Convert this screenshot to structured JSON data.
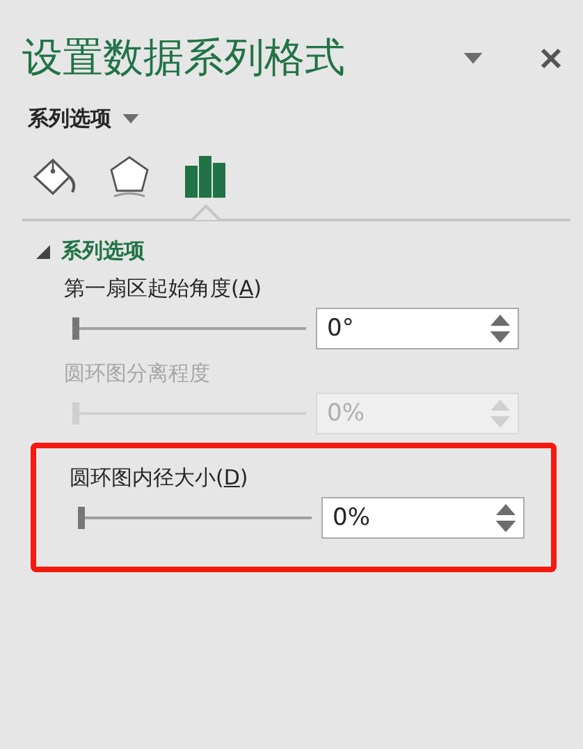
{
  "pane": {
    "title": "设置数据系列格式",
    "options_menu": "系列选项"
  },
  "icon_tabs": [
    {
      "kind": "fill",
      "selected": false
    },
    {
      "kind": "effects",
      "selected": false
    },
    {
      "kind": "series",
      "selected": true
    }
  ],
  "section": {
    "title": "系列选项",
    "expanded": true
  },
  "settings": [
    {
      "label": {
        "before": "第一扇区起始角度(",
        "key": "A",
        "after": ")"
      },
      "level": 0,
      "value": "0°",
      "disabled": false,
      "highlighted": false
    },
    {
      "label": {
        "before": "圆环图分离程度"
      },
      "level": 0,
      "value": "0%",
      "disabled": true,
      "highlighted": false
    },
    {
      "label": {
        "before": "圆环图内径大小(",
        "key": "D",
        "after": ")"
      },
      "level": 0,
      "value": "0%",
      "disabled": false,
      "highlighted": true
    }
  ]
}
